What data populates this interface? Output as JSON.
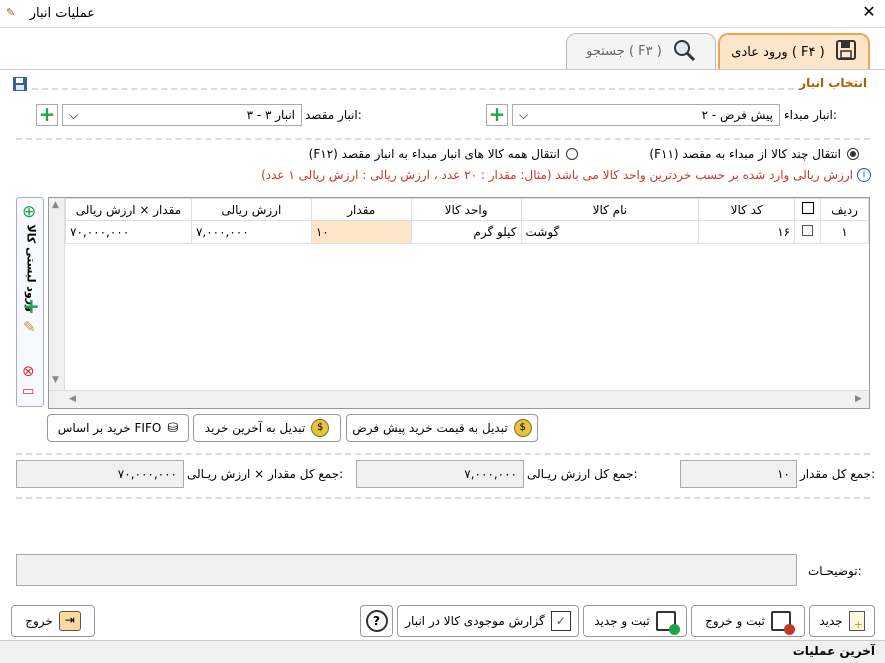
{
  "window": {
    "title": "عملیات انبار"
  },
  "tabs": [
    {
      "label": "ورود عادی ( F۴ )"
    },
    {
      "label": "جستجو ( F۳ )"
    }
  ],
  "section": {
    "title": "انتخاب انبار"
  },
  "source": {
    "label": "انبار مبداء:",
    "value": "پیش فرض - ۲"
  },
  "dest": {
    "label": "انبار مقصد:",
    "value": "انبار ۳ - ۳"
  },
  "options": {
    "opt1": "انتقال چند کالا از مبداء به مقصد (F۱۱)",
    "opt2": "انتقال همه کالا های انبار مبداء به انبار مقصد (F۱۲)",
    "info": "ارزش ریالی  وارد شده بر حسب خردترین واحد کالا می باشد (مثال:  مقدار : ۲۰ عدد  ،  ارزش ریالی : ارزش ریالی ۱ عدد)"
  },
  "table": {
    "headers": [
      "ردیف",
      "",
      "کد کالا",
      "نام کالا",
      "واحد کالا",
      "مقدار",
      "ارزش ریالی",
      "مقدار × ارزش ریالی"
    ],
    "rows": [
      {
        "idx": "۱",
        "code": "۱۶",
        "name": "گوشت",
        "unit": "کیلو گرم",
        "qty": "۱۰",
        "value": "۷,۰۰۰,۰۰۰",
        "total": "۷۰,۰۰۰,۰۰۰"
      }
    ]
  },
  "side": {
    "label": "ورود لیستی کالا"
  },
  "pricebtns": {
    "b1": "تبدیل به قیمت خرید پیش فرض",
    "b2": "تبدیل به آخرین خرید",
    "b3": "خرید بر اساس FIFO"
  },
  "totals": {
    "qty_label": "جمع کل مقدار:",
    "qty": "۱۰",
    "val_label": "جمع کل ارزش ریـالی:",
    "val": "۷,۰۰۰,۰۰۰",
    "tot_label": "جمع کل مقدار × ارزش ریـالی:",
    "tot": "۷۰,۰۰۰,۰۰۰"
  },
  "desc": {
    "label": "توضیحـات:"
  },
  "buttons": {
    "new": "جدید",
    "save_exit": "ثبت و خروج",
    "save_new": "ثبت و جدید",
    "report": "گزارش موجودی کالا در انبار",
    "help": "?",
    "exit": "خروج"
  },
  "footer": {
    "label": "آخرین عملیات"
  }
}
